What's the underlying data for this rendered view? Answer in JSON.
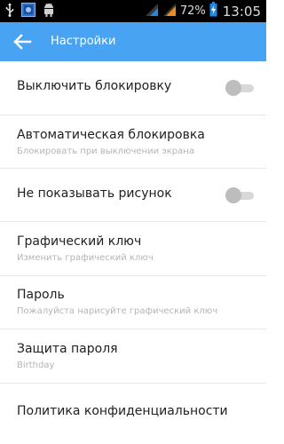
{
  "status_bar": {
    "battery_percent": "72%",
    "time": "13:05",
    "icons": [
      "usb-icon",
      "screenshot-icon",
      "android-debug-icon",
      "signal-1-icon",
      "signal-2-icon",
      "battery-charging-icon"
    ]
  },
  "app_bar": {
    "title": "Настройки",
    "color": "#48a3f2"
  },
  "settings": {
    "disable_lock": {
      "title": "Выключить блокировку",
      "enabled": false
    },
    "auto_lock": {
      "title": "Автоматическая блокировка",
      "subtitle": "Блокировать при выключении экрана"
    },
    "hide_pattern": {
      "title": "Не показывать рисунок",
      "enabled": false
    },
    "pattern_key": {
      "title": "Графический ключ",
      "subtitle": "Изменить графический ключ"
    },
    "password": {
      "title": "Пароль",
      "subtitle": "Пожалуйста нарисуйте графический ключ"
    },
    "password_protection": {
      "title": "Защита пароля",
      "subtitle": "Birthday"
    },
    "privacy_policy": {
      "title": "Политика конфиденциальности"
    }
  }
}
